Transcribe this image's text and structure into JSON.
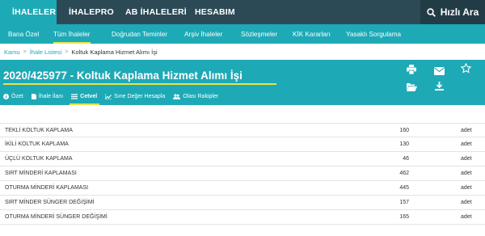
{
  "topnav": {
    "items": [
      {
        "label": "İHALELER",
        "icon": "document-icon",
        "active": true
      },
      {
        "label": "İHALEPRO",
        "icon": "chart-icon",
        "active": false
      },
      {
        "label": "AB İHALELERİ",
        "icon": "globe-icon",
        "active": false
      },
      {
        "label": "HESABIM",
        "icon": "user-icon",
        "active": false
      }
    ],
    "quick_search": "Hızlı Ara"
  },
  "subnav": {
    "items": [
      {
        "label": "Bana Özel",
        "active": false
      },
      {
        "label": "Tüm İhaleler",
        "active": true
      },
      {
        "label": "Doğrudan Teminler",
        "active": false
      },
      {
        "label": "Arşiv İhaleler",
        "active": false
      },
      {
        "label": "Sözleşmeler",
        "active": false
      },
      {
        "label": "KİK Kararları",
        "active": false
      },
      {
        "label": "Yasaklı Sorgulama",
        "active": false
      }
    ]
  },
  "breadcrumb": {
    "items": [
      "Kamu",
      "İhale Listesi"
    ],
    "current": "Koltuk Kaplama Hizmet Alımı İşi"
  },
  "page": {
    "title": "2020/425977 - Koltuk Kaplama Hizmet Alımı İşi",
    "tabs": [
      {
        "label": "Özet",
        "icon": "info-icon",
        "active": false
      },
      {
        "label": "İhale İlanı",
        "icon": "file-icon",
        "active": false
      },
      {
        "label": "Cetvel",
        "icon": "list-icon",
        "active": true
      },
      {
        "label": "Sıne Değer Hesapla",
        "icon": "chart-line-icon",
        "active": false
      },
      {
        "label": "Olası Rakipler",
        "icon": "users-icon",
        "active": false
      }
    ],
    "actions": [
      "print-icon",
      "mail-icon",
      "star-icon",
      "folder-open-icon",
      "download-icon"
    ]
  },
  "items": [
    {
      "name": "TEKLİ KOLTUK KAPLAMA",
      "qty": "160",
      "unit": "adet"
    },
    {
      "name": "İKİLİ KOLTUK KAPLAMA",
      "qty": "130",
      "unit": "adet"
    },
    {
      "name": "ÜÇLÜ KOLTUK KAPLAMA",
      "qty": "46",
      "unit": "adet"
    },
    {
      "name": "SIRT MİNDERİ KAPLAMASI",
      "qty": "462",
      "unit": "adet"
    },
    {
      "name": "OTURMA MİNDERİ KAPLAMASI",
      "qty": "445",
      "unit": "adet"
    },
    {
      "name": "SIRT MİNDER SÜNGER DEĞİŞİMİ",
      "qty": "157",
      "unit": "adet"
    },
    {
      "name": "OTURMA MİNDERİ SÜNGER DEĞİŞİMİ",
      "qty": "165",
      "unit": "adet"
    }
  ],
  "colors": {
    "topbar": "#2b4a56",
    "accent": "#1ea9b6",
    "highlight": "#e8e34a"
  }
}
